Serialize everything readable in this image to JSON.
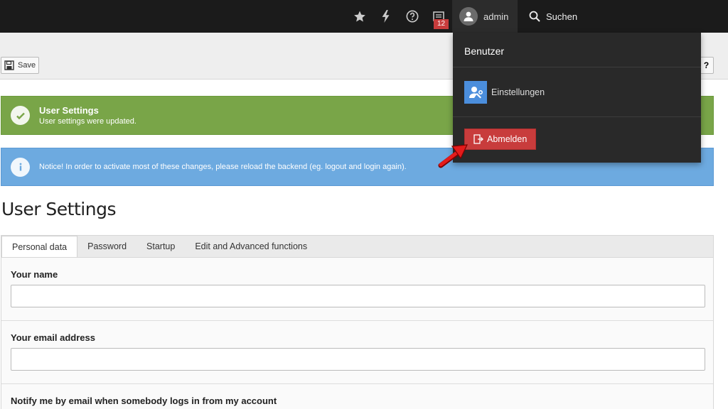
{
  "topbar": {
    "icons": [
      "star-icon",
      "flash-icon",
      "help-icon",
      "task-list-icon"
    ],
    "badge_count": "12",
    "user": {
      "name": "admin"
    },
    "search_label": "Suchen"
  },
  "docheader": {
    "save_label": "Save",
    "help_label": "?"
  },
  "alerts": {
    "success": {
      "title": "User Settings",
      "message": "User settings were updated."
    },
    "info": {
      "message": "Notice! In order to activate most of these changes, please reload the backend (eg. logout and login again)."
    }
  },
  "page_title": "User Settings",
  "tabs": [
    {
      "label": "Personal data",
      "active": true
    },
    {
      "label": "Password",
      "active": false
    },
    {
      "label": "Startup",
      "active": false
    },
    {
      "label": "Edit and Advanced functions",
      "active": false
    }
  ],
  "form": {
    "name_label": "Your name",
    "name_value": "",
    "email_label": "Your email address",
    "email_value": "",
    "notify_label": "Notify me by email when somebody logs in from my account"
  },
  "user_menu": {
    "header": "Benutzer",
    "settings_label": "Einstellungen",
    "logout_label": "Abmelden"
  },
  "colors": {
    "topbar": "#1b1b1b",
    "success": "#79a548",
    "info": "#6daae0",
    "logout": "#c83c3c",
    "badge": "#c83c3c"
  }
}
